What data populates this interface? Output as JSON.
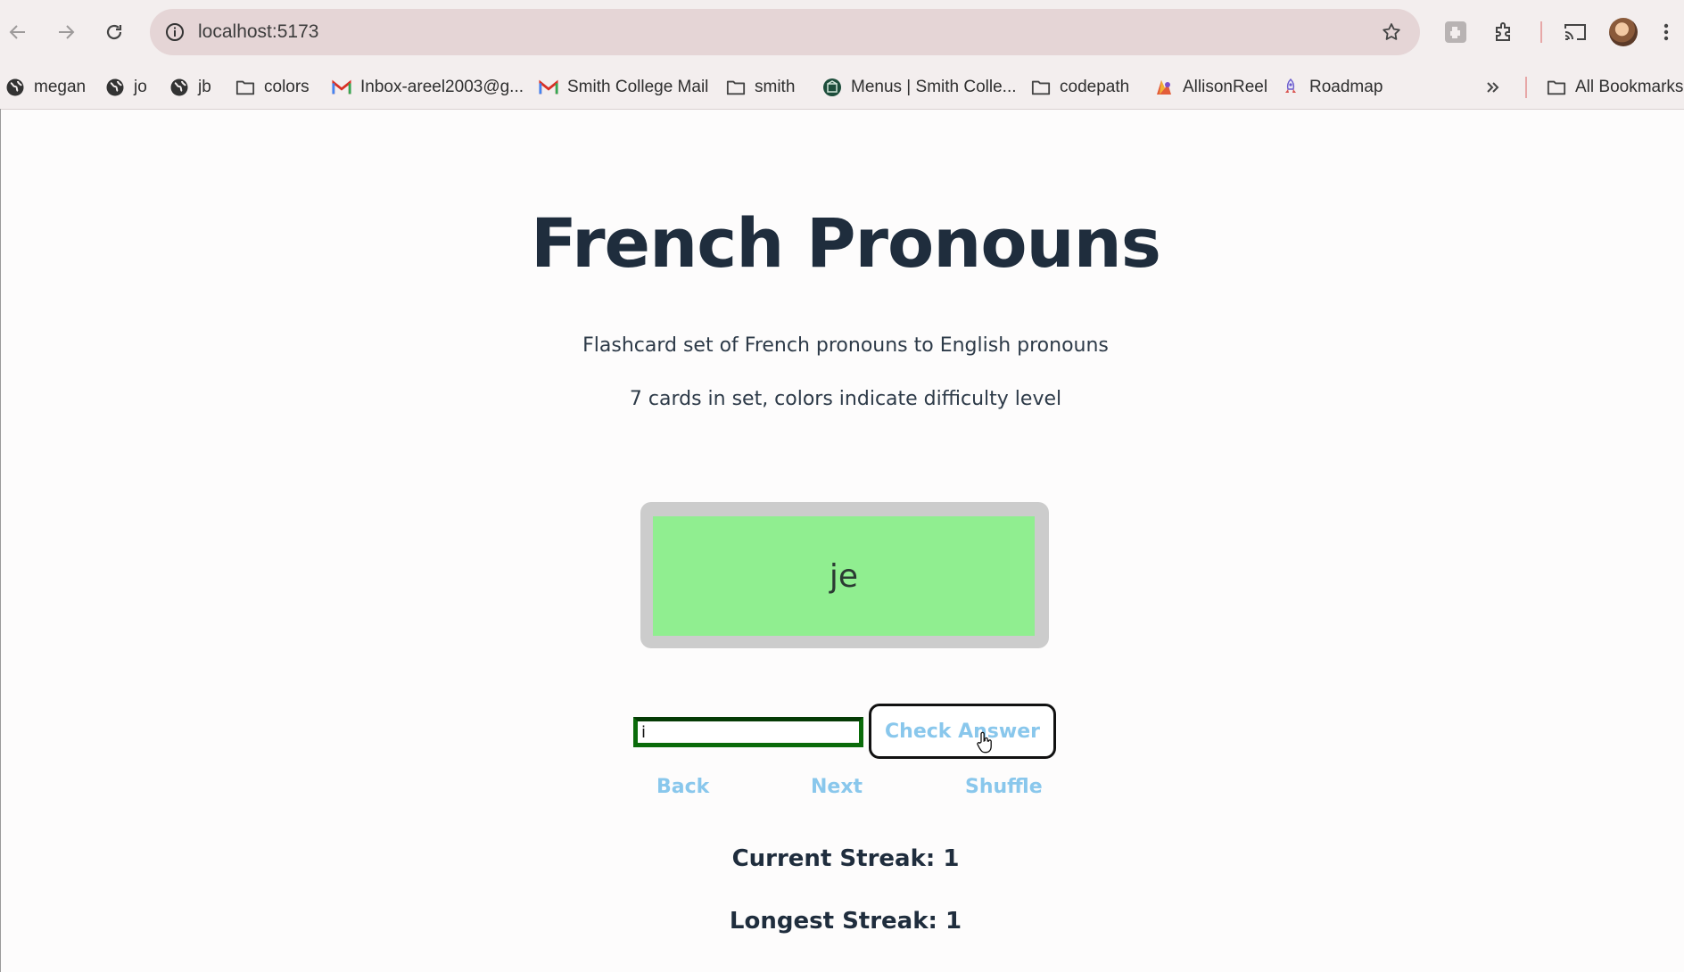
{
  "browser": {
    "url": "localhost:5173",
    "bookmarks": [
      {
        "label": "megan",
        "icon": "globe-icon"
      },
      {
        "label": "jo",
        "icon": "globe-icon"
      },
      {
        "label": "jb",
        "icon": "globe-icon"
      },
      {
        "label": "colors",
        "icon": "folder-icon"
      },
      {
        "label": "Inbox-areel2003@g...",
        "icon": "gmail-icon"
      },
      {
        "label": "Smith College Mail",
        "icon": "gmail-icon"
      },
      {
        "label": "smith",
        "icon": "folder-icon"
      },
      {
        "label": "Menus | Smith Colle...",
        "icon": "smith-logo-icon"
      },
      {
        "label": "codepath",
        "icon": "folder-icon"
      },
      {
        "label": "AllisonReel",
        "icon": "colorful-logo-icon"
      },
      {
        "label": "Roadmap",
        "icon": "rocket-icon"
      }
    ],
    "all_bookmarks_label": "All Bookmarks"
  },
  "page": {
    "title": "French Pronouns",
    "description": "Flashcard set of French pronouns to English pronouns",
    "card_count_text": "7 cards in set, colors indicate difficulty level",
    "card": {
      "text": "je",
      "color": "#90ee90"
    },
    "answer_input_value": "i",
    "check_button": "Check Answer",
    "nav": {
      "back": "Back",
      "next": "Next",
      "shuffle": "Shuffle"
    },
    "current_streak": "Current Streak: 1",
    "longest_streak": "Longest Streak: 1"
  }
}
